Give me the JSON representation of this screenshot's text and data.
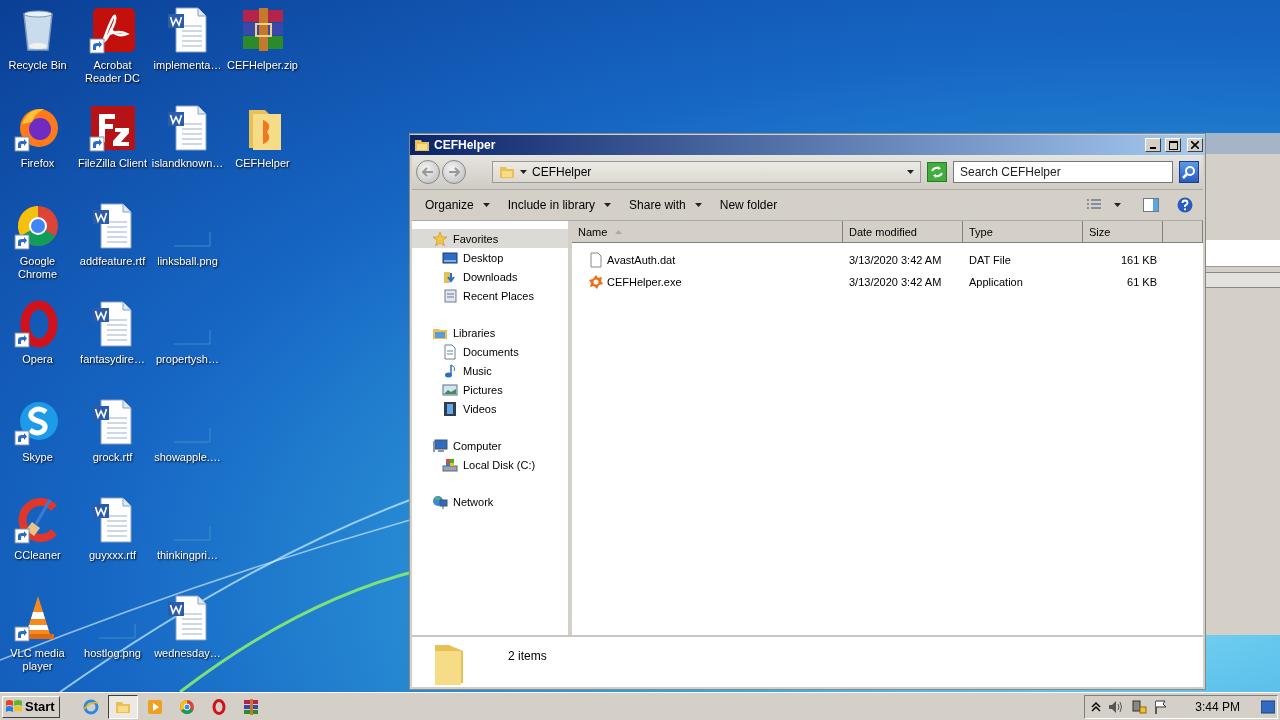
{
  "desktop": {
    "icons": [
      {
        "label": "Recycle Bin",
        "kind": "recycle",
        "shortcut": false
      },
      {
        "label": "Firefox",
        "kind": "firefox",
        "shortcut": true
      },
      {
        "label": "Google Chrome",
        "kind": "chrome",
        "shortcut": true
      },
      {
        "label": "Opera",
        "kind": "opera",
        "shortcut": true
      },
      {
        "label": "Skype",
        "kind": "skype",
        "shortcut": true
      },
      {
        "label": "CCleaner",
        "kind": "ccleaner",
        "shortcut": true
      },
      {
        "label": "VLC media player",
        "kind": "vlc",
        "shortcut": true
      },
      {
        "label": "Acrobat Reader DC",
        "kind": "acrobat",
        "shortcut": true
      },
      {
        "label": "FileZilla Client",
        "kind": "filezilla",
        "shortcut": true
      },
      {
        "label": "addfeature.rtf",
        "kind": "document",
        "shortcut": false
      },
      {
        "label": "fantasydire…",
        "kind": "document",
        "shortcut": false
      },
      {
        "label": "grock.rtf",
        "kind": "document",
        "shortcut": false
      },
      {
        "label": "guyxxx.rtf",
        "kind": "document",
        "shortcut": false
      },
      {
        "label": "hostlog.png",
        "kind": "image",
        "shortcut": false
      },
      {
        "label": "implementa…",
        "kind": "document",
        "shortcut": false
      },
      {
        "label": "islandknown…",
        "kind": "document",
        "shortcut": false
      },
      {
        "label": "linksball.png",
        "kind": "image",
        "shortcut": false
      },
      {
        "label": "propertysh…",
        "kind": "image",
        "shortcut": false
      },
      {
        "label": "showapple.…",
        "kind": "image",
        "shortcut": false
      },
      {
        "label": "thinkingpri…",
        "kind": "image",
        "shortcut": false
      },
      {
        "label": "wednesday…",
        "kind": "document",
        "shortcut": false
      },
      {
        "label": "CEFHelper.zip",
        "kind": "archive",
        "shortcut": false
      },
      {
        "label": "CEFHelper",
        "kind": "folder",
        "shortcut": false
      }
    ]
  },
  "window": {
    "title": "CEFHelper",
    "address": "CEFHelper",
    "search": {
      "placeholder": "Search CEFHelper"
    },
    "toolbar": [
      {
        "label": "Organize",
        "menu": true
      },
      {
        "label": "Include in library",
        "menu": true
      },
      {
        "label": "Share with",
        "menu": true
      },
      {
        "label": "New folder",
        "menu": false
      }
    ],
    "navigation": [
      {
        "label": "Favorites",
        "kind": "star",
        "selected": true,
        "children": [
          {
            "label": "Desktop",
            "kind": "desktop",
            "selected": false
          },
          {
            "label": "Downloads",
            "kind": "downloads",
            "selected": false
          },
          {
            "label": "Recent Places",
            "kind": "recent",
            "selected": false
          }
        ]
      },
      {
        "label": "Libraries",
        "kind": "library",
        "selected": false,
        "children": [
          {
            "label": "Documents",
            "kind": "documents",
            "selected": false
          },
          {
            "label": "Music",
            "kind": "music",
            "selected": false
          },
          {
            "label": "Pictures",
            "kind": "pictures",
            "selected": false
          },
          {
            "label": "Videos",
            "kind": "videos",
            "selected": false
          }
        ]
      },
      {
        "label": "Computer",
        "kind": "computer",
        "selected": false,
        "children": [
          {
            "label": "Local Disk (C:)",
            "kind": "disk",
            "selected": false
          }
        ]
      },
      {
        "label": "Network",
        "kind": "network",
        "selected": false
      }
    ],
    "columns": [
      {
        "label": "Name",
        "sorted": true
      },
      {
        "label": "Date modified",
        "sorted": false
      },
      {
        "label": "Type",
        "sorted": false
      },
      {
        "label": "Size",
        "sorted": false
      }
    ],
    "files": [
      {
        "name": "AvastAuth.dat",
        "date": "3/13/2020 3:42 AM",
        "type": "DAT File",
        "size": "161 KB",
        "kind": "blank"
      },
      {
        "name": "CEFHelper.exe",
        "date": "3/13/2020 3:42 AM",
        "type": "Application",
        "size": "61 KB",
        "kind": "avast"
      }
    ],
    "status": "2 items"
  },
  "taskbar": {
    "start": "Start",
    "apps": [
      {
        "kind": "ie",
        "selected": false
      },
      {
        "kind": "explorer",
        "selected": true
      },
      {
        "kind": "media",
        "selected": false
      },
      {
        "kind": "chrome",
        "selected": false
      },
      {
        "kind": "opera",
        "selected": false
      },
      {
        "kind": "winrar",
        "selected": false
      }
    ],
    "clock": "3:44 PM"
  }
}
